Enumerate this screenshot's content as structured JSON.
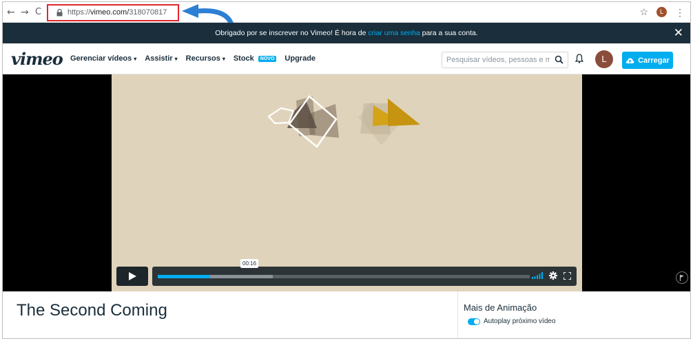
{
  "browser": {
    "url_scheme": "https://",
    "url_host": "vimeo.com/",
    "url_path": "318070817",
    "profile_initial": "L"
  },
  "notice": {
    "text_before": "Obrigado por se inscrever no Vimeo! É hora de",
    "link_text": "criar uma senha",
    "text_after": "para a sua conta.",
    "close": "✕"
  },
  "header": {
    "logo": "vimeo",
    "nav": [
      {
        "label": "Gerenciar vídeos",
        "chevron": true
      },
      {
        "label": "Assistir",
        "chevron": true
      },
      {
        "label": "Recursos",
        "chevron": true
      },
      {
        "label": "Stock",
        "badge": "NOVO"
      },
      {
        "label": "Upgrade"
      }
    ],
    "search_placeholder": "Pesquisar vídeos, pessoas e mais",
    "avatar_initial": "L",
    "upload_label": "Carregar",
    "accent_color": "#00adef"
  },
  "player": {
    "timecode": "00:16",
    "progress_played": 0.14,
    "progress_buffered": 0.31
  },
  "below": {
    "title": "The Second Coming",
    "more_heading": "Mais de Animação",
    "autoplay_label": "Autoplay próximo vídeo",
    "autoplay_on": true
  }
}
